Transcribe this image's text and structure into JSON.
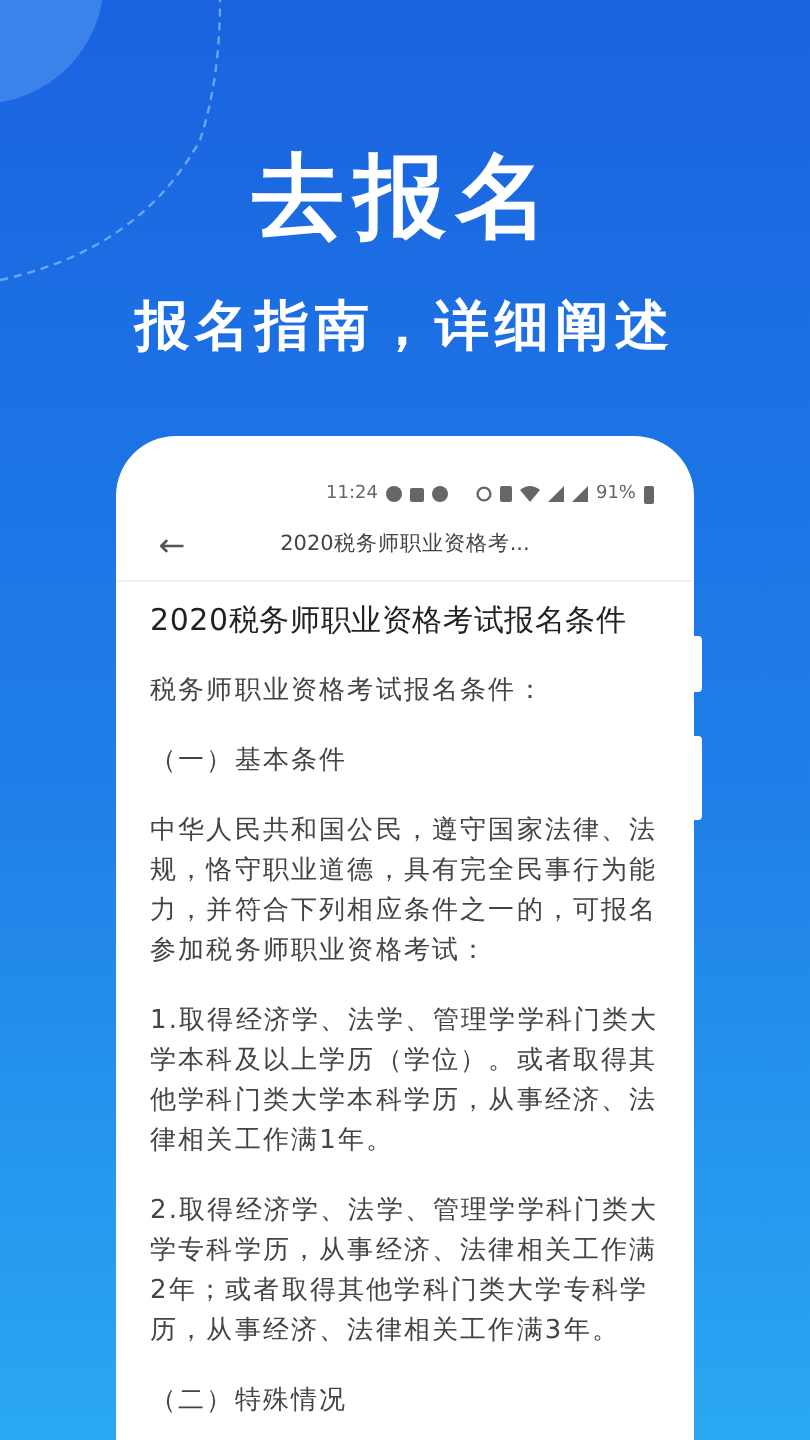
{
  "headline": "去报名",
  "subheadline": "报名指南，详细阐述",
  "phone": {
    "status_bar": {
      "time": "11:24",
      "battery": "91%"
    },
    "nav": {
      "back": "←",
      "title": "2020税务师职业资格考..."
    },
    "article": {
      "title": "2020税务师职业资格考试报名条件",
      "paragraphs": [
        "税务师职业资格考试报名条件：",
        "（一）基本条件",
        "中华人民共和国公民，遵守国家法律、法规，恪守职业道德，具有完全民事行为能力，并符合下列相应条件之一的，可报名参加税务师职业资格考试：",
        "1.取得经济学、法学、管理学学科门类大学本科及以上学历（学位）。或者取得其他学科门类大学本科学历，从事经济、法律相关工作满1年。",
        "2.取得经济学、法学、管理学学科门类大学专科学历，从事经济、法律相关工作满2年；或者取得其他学科门类大学专科学历，从事经济、法律相关工作满3年。",
        "（二）特殊情况"
      ]
    }
  }
}
